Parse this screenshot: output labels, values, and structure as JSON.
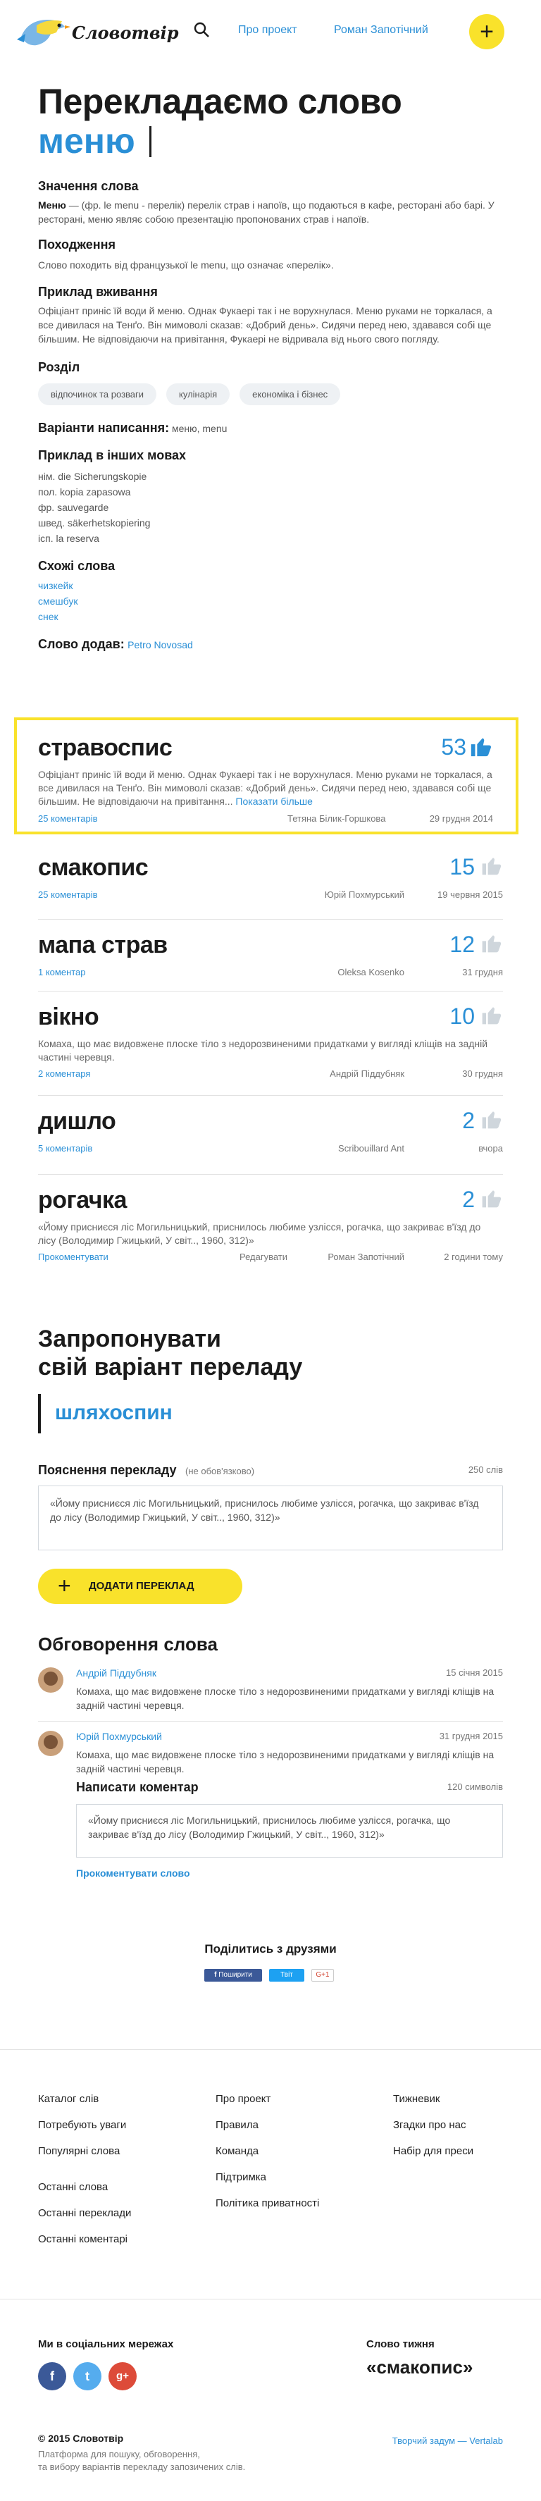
{
  "header": {
    "logo_text": "Словотвір",
    "nav": [
      "Про проект",
      "Роман Запотічний"
    ],
    "add_symbol": "+"
  },
  "hero": {
    "title_line1": "Перекладаємо слово",
    "title_word": "меню"
  },
  "info": {
    "meaning_heading": "Значення слова",
    "meaning_word": "Меню",
    "meaning_text": " — (фр. le menu - перелік) перелік страв і напоїв, що подаються в кафе, ресторані або барі. У ресторані, меню являє собою презентацію пропонованих страв і напоїв.",
    "origin_heading": "Походження",
    "origin_text": "Слово походить від французької le menu, що означає «перелік».",
    "usage_heading": "Приклад вживання",
    "usage_text": "Офіціант приніс їй води й меню. Однак Фукаері так і не ворухнулася. Меню руками не торкалася, а все дивилася на Тенґо. Він мимоволі сказав: «Добрий день». Сидячи перед нею, здавався собі ще більшим. Не відповідаючи на привітання, Фукаері не відривала від нього свого погляду.",
    "section_heading": "Розділ",
    "chips": [
      "відпочинок та розваги",
      "кулінарія",
      "економіка і бізнес"
    ],
    "variants_label": "Варіанти написання:",
    "variants_value": " меню, menu",
    "other_lang_heading": "Приклад в інших мовах",
    "other_langs": [
      "нім. die Sicherungskopie",
      "пол. kopia zapasowa",
      "фр. sauvegarde",
      "швед. säkerhetskopiering",
      "ісп. la reserva"
    ],
    "similar_heading": "Схожі слова",
    "similar": [
      "чизкейк",
      "смешбук",
      "снек"
    ],
    "added_by_label": "Слово додав:",
    "added_by": "Petro Novosad"
  },
  "translations": [
    {
      "word": "стравоспис",
      "votes": "53",
      "thumb_color": "#2a8fd6",
      "text": "Офіціант приніс їй води й меню. Однак Фукаері так і не ворухнулася. Меню руками не торкалася, а все дивилася на Тенґо. Він мимоволі сказав: «Добрий день». Сидячи перед нею, здавався собі ще більшим. Не відповідаючи на привітання...",
      "more": "Показати більше",
      "comments": "25 коментарів",
      "author": "Тетяна Білик-Горшкова",
      "date": "29 грудня 2014"
    },
    {
      "word": "смакопис",
      "votes": "15",
      "thumb_color": "#cfd6dc",
      "text": "",
      "comments": "25 коментарів",
      "author": "Юрій Похмурський",
      "date": "19 червня 2015"
    },
    {
      "word": "мапа страв",
      "votes": "12",
      "thumb_color": "#cfd6dc",
      "text": "",
      "comments": "1 коментар",
      "author": "Oleksa Kosenko",
      "date": "31 грудня"
    },
    {
      "word": "вікно",
      "votes": "10",
      "thumb_color": "#cfd6dc",
      "text": "Комаха, що має видовжене плоске тіло з недорозвиненими придатками у вигляді кліщів на задній частині черевця.",
      "comments": "2 коментаря",
      "author": "Андрій Піддубняк",
      "date": "30 грудня"
    },
    {
      "word": "дишло",
      "votes": "2",
      "thumb_color": "#cfd6dc",
      "text": "",
      "comments": "5 коментарів",
      "author": "Scribouillard Ant",
      "date": "вчора"
    },
    {
      "word": "рогачка",
      "votes": "2",
      "thumb_color": "#cfd6dc",
      "text": "«Йому присниєся ліс Могильницький, приснилось любиме узлісся, рогачка, що закриває в'їзд до лісу (Володимир Гжицький, У світ.., 1960, 312)»",
      "comments": "Прокоментувати",
      "edit": "Редагувати",
      "author": "Роман Запотічний",
      "date": "2 години тому"
    }
  ],
  "propose": {
    "heading_line1": "Запропонувати",
    "heading_line2": "свій варіант переладу",
    "input_value": "шляхоспин",
    "explain_label": "Пояснення перекладу",
    "explain_optional": "(не обов'язково)",
    "explain_counter": "250 слів",
    "explain_text": "«Йому присниєся ліс Могильницький, приснилось любиме узлісся, рогачка, що закриває в'їзд до лісу (Володимир Гжицький, У світ.., 1960, 312)»",
    "add_button": "ДОДАТИ ПЕРЕКЛАД"
  },
  "discussion": {
    "heading": "Обговорення слова",
    "comments": [
      {
        "author": "Андрій Піддубняк",
        "date": "15 січня 2015",
        "text": "Комаха, що має видовжене плоске тіло з недорозвиненими придатками у вигляді кліщів на задній частині черевця."
      },
      {
        "author": "Юрій Похмурський",
        "date": "31 грудня 2015",
        "text": "Комаха, що має видовжене плоске тіло з недорозвиненими придатками у вигляді кліщів на задній частині черевця."
      }
    ],
    "write_heading": "Написати коментар",
    "write_counter": "120 символів",
    "write_text": "«Йому присниєся ліс Могильницький, приснилось любиме узлісся, рогачка, що закриває в'їзд до лісу (Володимир Гжицький, У світ.., 1960, 312)»",
    "submit_link": "Прокоментувати слово"
  },
  "share": {
    "heading": "Поділитись з друзями",
    "buttons": [
      "Поширити",
      "Твіт",
      "G+1"
    ]
  },
  "footer": {
    "col1": [
      "Каталог слів",
      "Потребують уваги",
      "Популярні слова",
      "Останні слова",
      "Останні переклади",
      "Останні коментарі"
    ],
    "col2": [
      "Про проект",
      "Правила",
      "Команда",
      "Підтримка",
      "Політика приватності"
    ],
    "col3": [
      "Тижневик",
      "Згадки про нас",
      "Набір для преси"
    ],
    "social_heading": "Ми в соціальних мережах",
    "social": [
      "f",
      "t",
      "g+"
    ],
    "word_of_week_label": "Слово тижня",
    "word_of_week": "«смакопис»",
    "copyright": "© 2015 Словотвір",
    "tagline_1": "Платформа для пошуку, обговорення,",
    "tagline_2": "та вибору варіантів перекладу запозичених слів.",
    "credits": "Творчий задум — Vertalab"
  }
}
